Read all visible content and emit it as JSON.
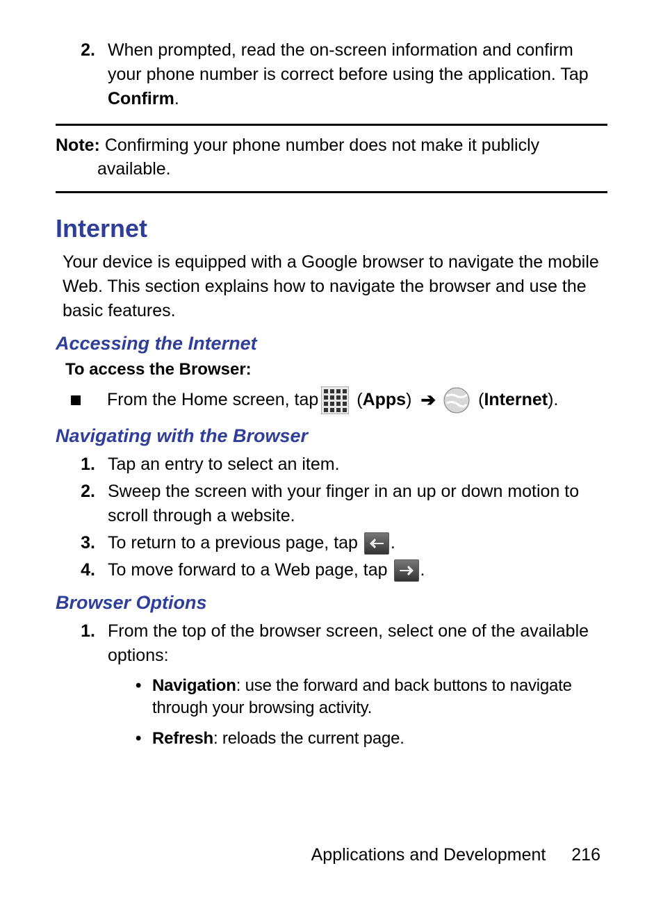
{
  "top_step": {
    "num": "2.",
    "text_a": "When prompted, read the on-screen information and confirm your phone number is correct before using the application. Tap ",
    "bold": "Confirm",
    "text_b": "."
  },
  "note": {
    "label": "Note:",
    "line1": " Confirming your phone number does not make it publicly",
    "line2": "available."
  },
  "h1": "Internet",
  "intro": "Your device is equipped with a Google browser to navigate the mobile Web. This section explains how to navigate the browser and use the basic features.",
  "h2_access": "Accessing the Internet",
  "access_lead": "To access the Browser:",
  "access_row": {
    "pre": "From the Home screen, tap ",
    "apps_label": "Apps",
    "internet_label": "Internet"
  },
  "h2_nav": "Navigating with the Browser",
  "nav_steps": [
    {
      "num": "1.",
      "text": "Tap an entry to select an item."
    },
    {
      "num": "2.",
      "text": "Sweep the screen with your finger in an up or down motion to scroll through a website."
    },
    {
      "num": "3.",
      "pre": "To return to a previous page, tap ",
      "post": "."
    },
    {
      "num": "4.",
      "pre": "To move forward to a Web page, tap ",
      "post": "."
    }
  ],
  "h2_opts": "Browser Options",
  "opts_step": {
    "num": "1.",
    "text": "From the top of the browser screen, select one of the available options:"
  },
  "opts_bullets": [
    {
      "lead": "Navigation",
      "rest": ": use the forward and back buttons to navigate through your browsing activity."
    },
    {
      "lead": "Refresh",
      "rest": ": reloads the current page."
    }
  ],
  "footer": {
    "section": "Applications and Development",
    "page": "216"
  }
}
